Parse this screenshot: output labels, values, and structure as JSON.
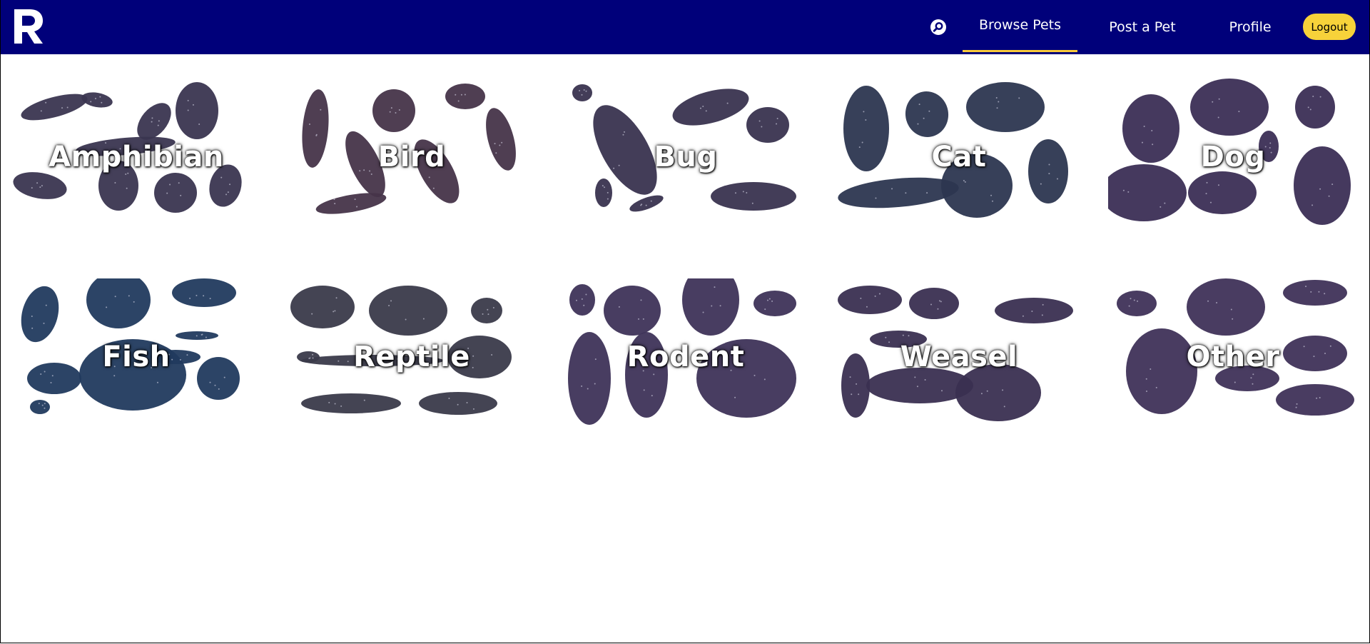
{
  "nav": {
    "logo_icon": "letter-r-logo",
    "search_icon": "search-icon",
    "links": {
      "browse": "Browse Pets",
      "post": "Post a Pet",
      "profile": "Profile"
    },
    "logout": "Logout",
    "active": "Browse Pets",
    "colors": {
      "bar": "#00007a",
      "accent": "#f7c83b",
      "logout_bg": "#f7d23a"
    }
  },
  "categories": [
    {
      "label": "Amphibian",
      "color": "#3a3550"
    },
    {
      "label": "Bird",
      "color": "#463449"
    },
    {
      "label": "Bug",
      "color": "#39334f"
    },
    {
      "label": "Cat",
      "color": "#2c3650"
    },
    {
      "label": "Dog",
      "color": "#3b2e55"
    },
    {
      "label": "Fish",
      "color": "#213a5e"
    },
    {
      "label": "Reptile",
      "color": "#3a3a4a"
    },
    {
      "label": "Rodent",
      "color": "#3e3358"
    },
    {
      "label": "Weasel",
      "color": "#3a2f51"
    },
    {
      "label": "Other",
      "color": "#3f3258"
    }
  ]
}
